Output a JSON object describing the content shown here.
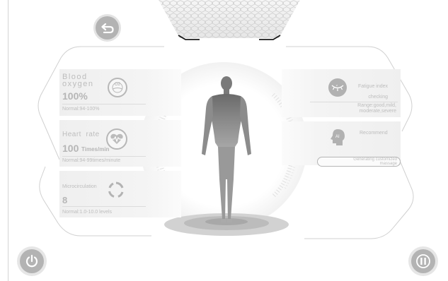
{
  "colors": {
    "panel": "#efefef",
    "icon": "#b3b3b3",
    "text": "#bdbdbd",
    "outline": "#c9c9c9"
  },
  "top_bar": {
    "back_icon": "back-arrow-icon"
  },
  "left_panel": {
    "blood_oxygen": {
      "title": "Blood\noxygen",
      "value": "100%",
      "normal": "Normal:94-100%",
      "icon": "o2-icon",
      "icon_text": "O2"
    },
    "heart_rate": {
      "title": "Heart  rate",
      "value": "100",
      "unit": "Times/min",
      "normal": "Normal:94-99times/minute",
      "icon": "heart-pulse-icon"
    },
    "microcirculation": {
      "title": "Microcirculation",
      "value": "8",
      "normal": "Normal:1.0-10.0 levels",
      "icon": "circulation-icon"
    }
  },
  "right_panel": {
    "fatigue": {
      "title": "Fatigue index\nchecking",
      "range": "Range:good,mild,\nmoderate,severe",
      "icon": "eye-icon"
    },
    "recommend": {
      "title": "Recommend",
      "status": "Generating customized\nmassage",
      "icon": "ai-head-icon",
      "icon_text": "AI"
    }
  },
  "bottom": {
    "power_icon": "power-icon",
    "pause_icon": "pause-icon"
  }
}
